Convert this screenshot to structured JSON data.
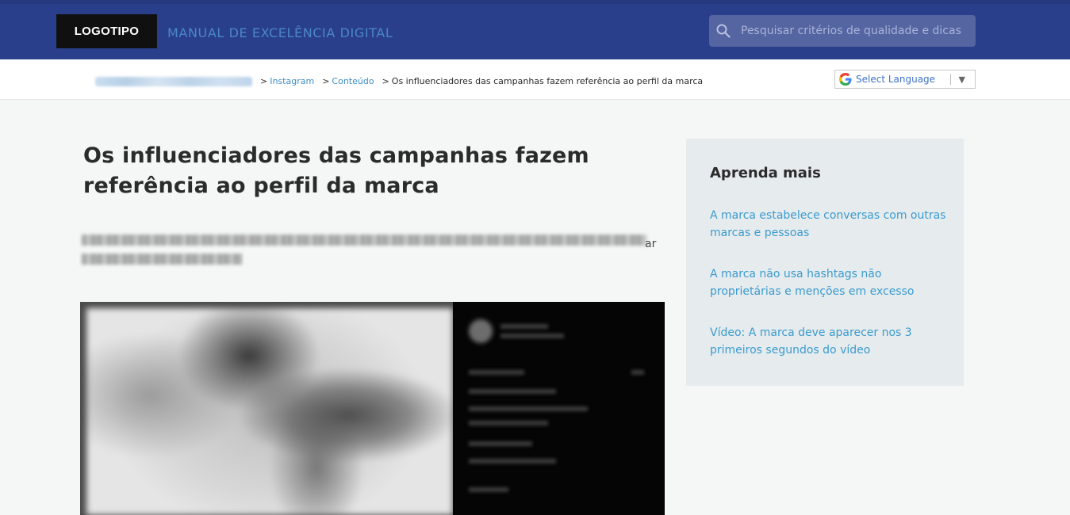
{
  "header": {
    "logo": "LOGOTIPO",
    "site_title": "MANUAL DE EXCELÊNCIA DIGITAL",
    "search_placeholder": "Pesquisar critérios de qualidade e dicas"
  },
  "breadcrumb": {
    "items": [
      {
        "label": "Instagram"
      },
      {
        "label": "Conteúdo"
      }
    ],
    "separator": ">",
    "current": "Os influenciadores das campanhas fazem referência ao perfil da marca"
  },
  "language": {
    "label": "Select Language"
  },
  "article": {
    "title": "Os influenciadores das campanhas fazem referência ao perfil da marca",
    "lead_visible_tail": "ar"
  },
  "aside": {
    "title": "Aprenda mais",
    "links": [
      {
        "label": "A marca estabelece conversas com outras marcas e pessoas"
      },
      {
        "label": "A marca não usa hashtags não proprietárias e menções em excesso"
      },
      {
        "label": "Vídeo: A marca deve aparecer nos 3 primeiros segundos do vídeo"
      }
    ]
  },
  "colors": {
    "header_bg": "#2a3f8c",
    "link": "#3a9bcf",
    "page_bg": "#f5f7f7",
    "aside_bg": "#e6ebed"
  }
}
